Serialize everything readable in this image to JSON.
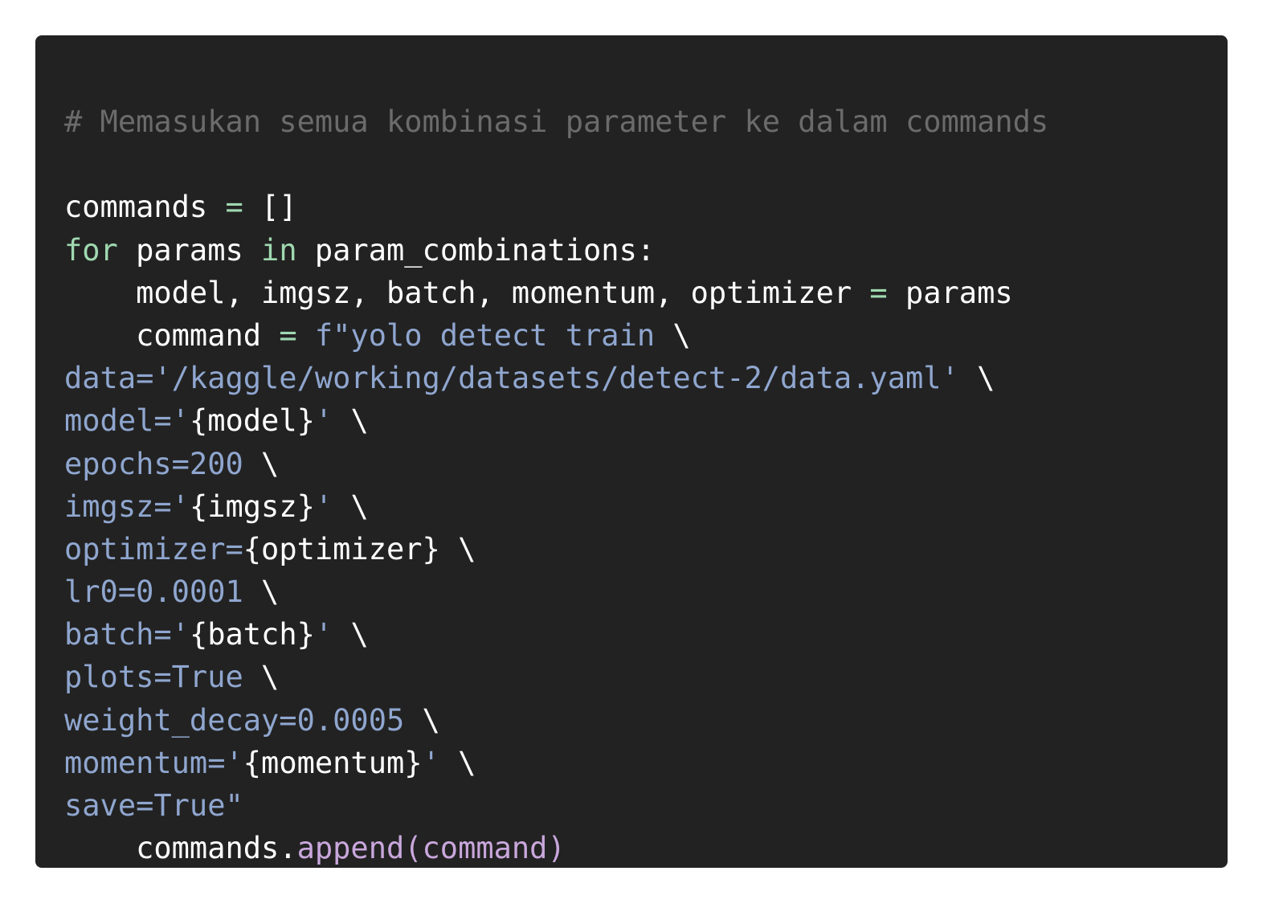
{
  "colors": {
    "background": "#ffffff",
    "card": "#222222",
    "comment": "#6b6b6b",
    "keyword": "#9fd9b0",
    "plain": "#ffffff",
    "string": "#8fa6cf",
    "call": "#c9a7dc"
  },
  "code": {
    "lines": [
      [
        {
          "t": "comment",
          "v": "# Memasukan semua kombinasi parameter ke dalam commands"
        }
      ],
      [],
      [
        {
          "t": "plain",
          "v": "commands "
        },
        {
          "t": "op",
          "v": "="
        },
        {
          "t": "plain",
          "v": " []"
        }
      ],
      [
        {
          "t": "kw",
          "v": "for"
        },
        {
          "t": "plain",
          "v": " params "
        },
        {
          "t": "kw",
          "v": "in"
        },
        {
          "t": "plain",
          "v": " param_combinations:"
        }
      ],
      [
        {
          "t": "plain",
          "v": "    model, imgsz, batch, momentum, optimizer "
        },
        {
          "t": "op",
          "v": "="
        },
        {
          "t": "plain",
          "v": " params"
        }
      ],
      [
        {
          "t": "plain",
          "v": "    command "
        },
        {
          "t": "op",
          "v": "="
        },
        {
          "t": "plain",
          "v": " "
        },
        {
          "t": "str",
          "v": "f\"yolo detect train "
        },
        {
          "t": "plain",
          "v": "\\"
        }
      ],
      [
        {
          "t": "str",
          "v": "data='/kaggle/working/datasets/detect-2/data.yaml' "
        },
        {
          "t": "plain",
          "v": "\\"
        }
      ],
      [
        {
          "t": "str",
          "v": "model='"
        },
        {
          "t": "plain",
          "v": "{model}"
        },
        {
          "t": "str",
          "v": "' "
        },
        {
          "t": "plain",
          "v": "\\"
        }
      ],
      [
        {
          "t": "str",
          "v": "epochs=200 "
        },
        {
          "t": "plain",
          "v": "\\"
        }
      ],
      [
        {
          "t": "str",
          "v": "imgsz='"
        },
        {
          "t": "plain",
          "v": "{imgsz}"
        },
        {
          "t": "str",
          "v": "' "
        },
        {
          "t": "plain",
          "v": "\\"
        }
      ],
      [
        {
          "t": "str",
          "v": "optimizer="
        },
        {
          "t": "plain",
          "v": "{optimizer} \\"
        }
      ],
      [
        {
          "t": "str",
          "v": "lr0=0.0001 "
        },
        {
          "t": "plain",
          "v": "\\"
        }
      ],
      [
        {
          "t": "str",
          "v": "batch='"
        },
        {
          "t": "plain",
          "v": "{batch}"
        },
        {
          "t": "str",
          "v": "' "
        },
        {
          "t": "plain",
          "v": "\\"
        }
      ],
      [
        {
          "t": "str",
          "v": "plots=True "
        },
        {
          "t": "plain",
          "v": "\\"
        }
      ],
      [
        {
          "t": "str",
          "v": "weight_decay=0.0005 "
        },
        {
          "t": "plain",
          "v": "\\"
        }
      ],
      [
        {
          "t": "str",
          "v": "momentum='"
        },
        {
          "t": "plain",
          "v": "{momentum}"
        },
        {
          "t": "str",
          "v": "' "
        },
        {
          "t": "plain",
          "v": "\\"
        }
      ],
      [
        {
          "t": "str",
          "v": "save=True\""
        }
      ],
      [
        {
          "t": "plain",
          "v": "    commands."
        },
        {
          "t": "call",
          "v": "append(command)"
        }
      ]
    ]
  }
}
